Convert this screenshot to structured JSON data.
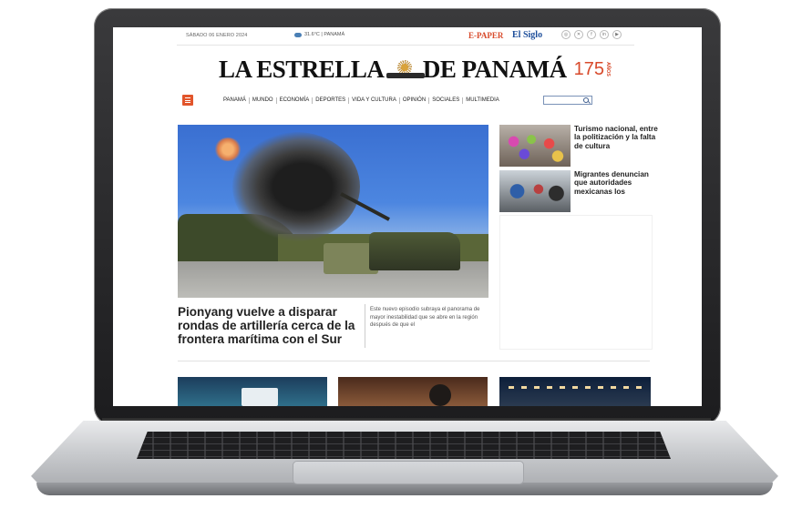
{
  "topbar": {
    "date": "SÁBADO 06 ENERO 2024",
    "weather": "31.6°C | PANAMÁ",
    "epaper": "E-PAPER",
    "elsiglo": "El Siglo",
    "social_icons": [
      "instagram-icon",
      "x-icon",
      "facebook-icon",
      "linkedin-icon",
      "youtube-icon"
    ]
  },
  "masthead": {
    "left": "LA ESTRELLA",
    "right": "DE PANAMÁ",
    "anniversary_number": "175",
    "anniversary_label": "AÑOS"
  },
  "nav": {
    "items": [
      "PANAMÁ",
      "MUNDO",
      "ECONOMÍA",
      "DEPORTES",
      "VIDA Y CULTURA",
      "OPINIÓN",
      "SOCIALES",
      "MULTIMEDIA"
    ]
  },
  "hero": {
    "title": "Pionyang vuelve a disparar rondas de artillería cerca de la frontera marítima con el Sur",
    "description": "Este nuevo episodio subraya el panorama de mayor inestabilidad que se abre en la región después de que el"
  },
  "side_stories": [
    {
      "title": "Turismo nacional, entre la politización y la falta de cultura"
    },
    {
      "title": "Migrantes denuncian que autoridades mexicanas los"
    }
  ],
  "colors": {
    "accent": "#e2552b",
    "elsiglo_blue": "#1c4d9a"
  }
}
